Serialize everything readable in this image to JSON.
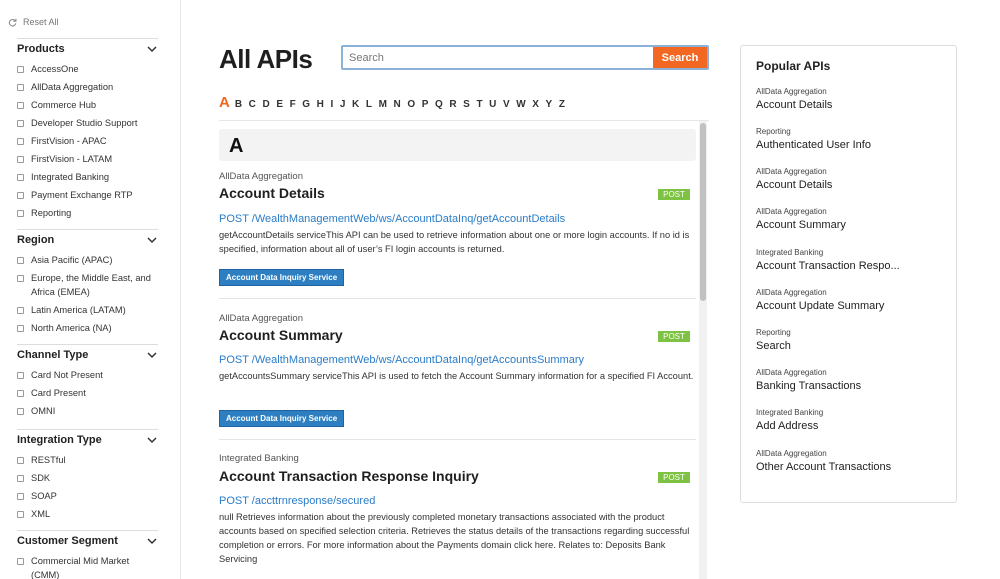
{
  "sidebar": {
    "reset_label": "Reset All",
    "facets": [
      {
        "title": "Products",
        "options": [
          "AccessOne",
          "AllData Aggregation",
          "Commerce Hub",
          "Developer Studio Support",
          "FirstVision - APAC",
          "FirstVision - LATAM",
          "Integrated Banking",
          "Payment Exchange RTP",
          "Reporting"
        ]
      },
      {
        "title": "Region",
        "options": [
          "Asia Pacific (APAC)",
          "Europe, the Middle East, and Africa (EMEA)",
          "Latin America (LATAM)",
          "North America (NA)"
        ]
      },
      {
        "title": "Channel Type",
        "options": [
          "Card Not Present",
          "Card Present",
          "OMNI"
        ]
      },
      {
        "title": "Integration Type",
        "options": [
          "RESTful",
          "SDK",
          "SOAP",
          "XML"
        ]
      },
      {
        "title": "Customer Segment",
        "options": [
          "Commercial Mid Market (CMM)"
        ]
      }
    ]
  },
  "main": {
    "title": "All APIs",
    "search": {
      "placeholder": "Search",
      "button_label": "Search"
    },
    "alphabet": [
      "A",
      "B",
      "C",
      "D",
      "E",
      "F",
      "G",
      "H",
      "I",
      "J",
      "K",
      "L",
      "M",
      "N",
      "O",
      "P",
      "Q",
      "R",
      "S",
      "T",
      "U",
      "V",
      "W",
      "X",
      "Y",
      "Z"
    ],
    "active_letter": "A",
    "letter_header": "A",
    "results": [
      {
        "category": "AllData Aggregation",
        "title": "Account Details",
        "method_badge": "POST",
        "path": "POST  /WealthManagementWeb/ws/AccountDataInq/getAccountDetails",
        "description": "getAccountDetails serviceThis API can be used to retrieve information about one or more login accounts. If no id is specified, information about all of user’s FI login accounts is returned.",
        "service_label": "Account Data Inquiry Service"
      },
      {
        "category": "AllData Aggregation",
        "title": "Account Summary",
        "method_badge": "POST",
        "path": "POST  /WealthManagementWeb/ws/AccountDataInq/getAccountsSummary",
        "description": "getAccountsSummary serviceThis API is used to fetch the Account Summary information for a specified FI Account.",
        "service_label": "Account Data Inquiry Service"
      },
      {
        "category": "Integrated Banking",
        "title": "Account Transaction Response Inquiry",
        "method_badge": "POST",
        "path": "POST  /accttrnresponse/secured",
        "description": "null Retrieves information about the previously completed monetary transactions associated with the product accounts based on specified selection criteria. Retrieves the status details of the transactions regarding successful completion or errors. For more information about the Payments domain click here. Relates to: Deposits Bank Servicing",
        "service_label": ""
      }
    ]
  },
  "popular": {
    "title": "Popular APIs",
    "items": [
      {
        "category": "AllData Aggregation",
        "name": "Account Details"
      },
      {
        "category": "Reporting",
        "name": "Authenticated User Info"
      },
      {
        "category": "AllData Aggregation",
        "name": "Account Details"
      },
      {
        "category": "AllData Aggregation",
        "name": "Account Summary"
      },
      {
        "category": "Integrated Banking",
        "name": "Account Transaction Respo..."
      },
      {
        "category": "AllData Aggregation",
        "name": "Account Update Summary"
      },
      {
        "category": "Reporting",
        "name": "Search"
      },
      {
        "category": "AllData Aggregation",
        "name": "Banking Transactions"
      },
      {
        "category": "Integrated Banking",
        "name": "Add Address"
      },
      {
        "category": "AllData Aggregation",
        "name": "Other Account Transactions"
      }
    ]
  },
  "colors": {
    "accent": "#f26722",
    "link": "#2a7cc7",
    "badge": "#7dc242",
    "service_button": "#2d7fc1"
  },
  "icons": {
    "reset": "refresh-icon",
    "facet_toggle": "chevron-down-icon"
  }
}
